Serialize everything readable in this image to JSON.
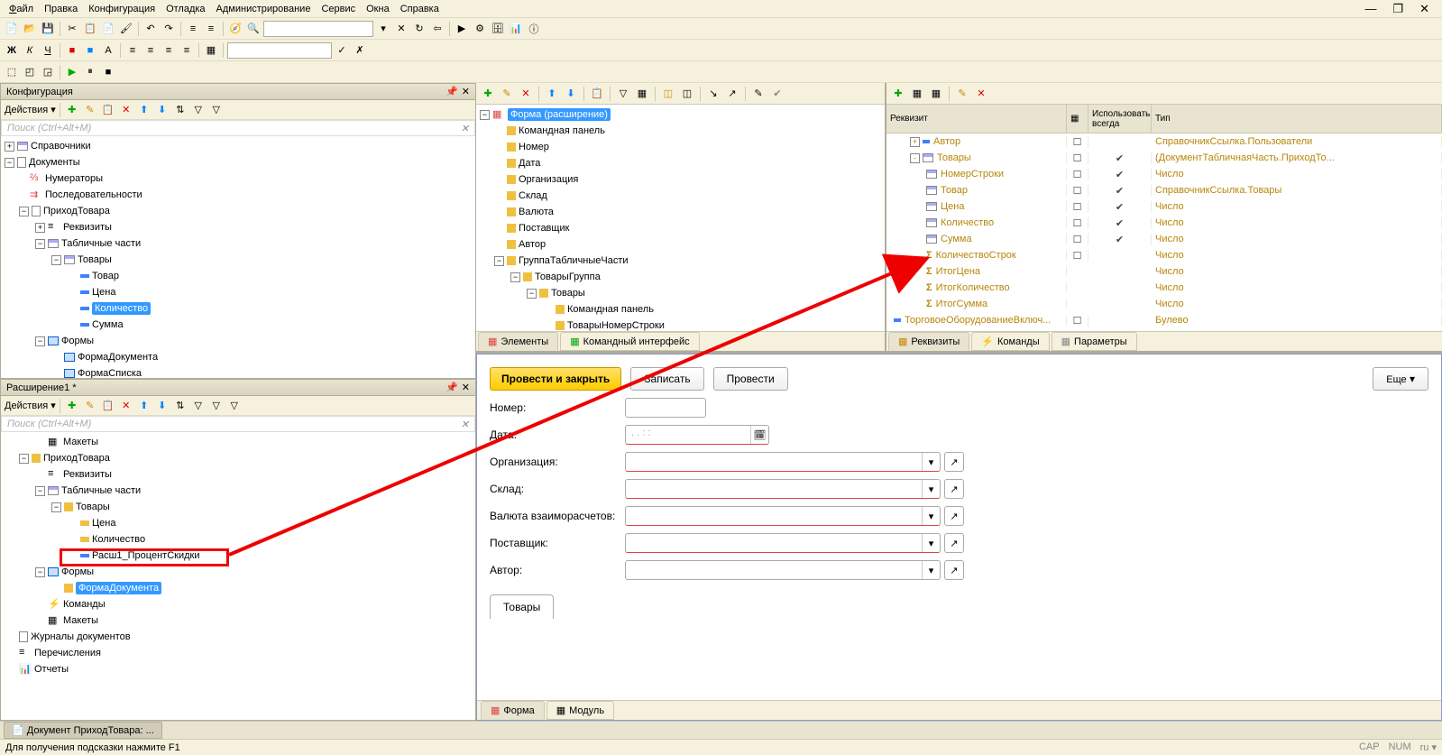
{
  "menu": [
    "Файл",
    "Правка",
    "Конфигурация",
    "Отладка",
    "Администрирование",
    "Сервис",
    "Окна",
    "Справка"
  ],
  "panels": {
    "config": {
      "title": "Конфигурация",
      "actions": "Действия",
      "search": "Поиск (Ctrl+Alt+M)"
    },
    "ext": {
      "title": "Расширение1 *",
      "actions": "Действия",
      "search": "Поиск (Ctrl+Alt+M)"
    }
  },
  "cfgTree": {
    "spravochniki": "Справочники",
    "dokumenty": "Документы",
    "numeratory": "Нумераторы",
    "posled": "Последовательности",
    "prihod": "ПриходТовара",
    "rekvizity": "Реквизиты",
    "tabparts": "Табличные части",
    "tovary": "Товары",
    "tovar": "Товар",
    "cena": "Цена",
    "kolvo": "Количество",
    "summa": "Сумма",
    "formy": "Формы",
    "formaDoc": "ФормаДокумента",
    "formaList": "ФормаСписка"
  },
  "extTree": {
    "makety": "Макеты",
    "prihod": "ПриходТовара",
    "rekvizity": "Реквизиты",
    "tabparts": "Табличные части",
    "tovary": "Товары",
    "cena": "Цена",
    "kolvo": "Количество",
    "rassh": "Расш1_ПроцентСкидки",
    "formy": "Формы",
    "formaDoc": "ФормаДокумента",
    "komandy": "Команды",
    "makety2": "Макеты",
    "zhurnaly": "Журналы документов",
    "perech": "Перечисления",
    "otchety": "Отчеты"
  },
  "formTree": {
    "forma": "Форма (расширение)",
    "cmdpanel": "Командная панель",
    "nomer": "Номер",
    "data": "Дата",
    "org": "Организация",
    "sklad": "Склад",
    "valuta": "Валюта",
    "postav": "Поставщик",
    "avtor": "Автор",
    "grptab": "ГруппаТабличныеЧасти",
    "tovgrp": "ТоварыГруппа",
    "tovary": "Товары",
    "cmdpanel2": "Командная панель",
    "tovnomer": "ТоварыНомерСтроки"
  },
  "elemTabs": {
    "elements": "Элементы",
    "cmdint": "Командный интерфейс"
  },
  "attrHeader": {
    "rekv": "Реквизит",
    "use": "Использовать всегда",
    "tip": "Тип"
  },
  "attrs": [
    {
      "ind": 1,
      "exp": "+",
      "icon": "blue",
      "name": "Автор",
      "c2": "☐",
      "c3": "",
      "tip": "СправочникСсылка.Пользователи"
    },
    {
      "ind": 1,
      "exp": "-",
      "icon": "grid",
      "name": "Товары",
      "c2": "☐",
      "c3": "✔",
      "tip": "(ДокументТабличнаяЧасть.ПриходТо..."
    },
    {
      "ind": 2,
      "icon": "grid",
      "name": "НомерСтроки",
      "c2": "☐",
      "c3": "✔",
      "tip": "Число"
    },
    {
      "ind": 2,
      "icon": "grid",
      "name": "Товар",
      "c2": "☐",
      "c3": "✔",
      "tip": "СправочникСсылка.Товары"
    },
    {
      "ind": 2,
      "icon": "grid",
      "name": "Цена",
      "c2": "☐",
      "c3": "✔",
      "tip": "Число"
    },
    {
      "ind": 2,
      "icon": "grid",
      "name": "Количество",
      "c2": "☐",
      "c3": "✔",
      "tip": "Число"
    },
    {
      "ind": 2,
      "icon": "grid",
      "name": "Сумма",
      "c2": "☐",
      "c3": "✔",
      "tip": "Число"
    },
    {
      "ind": 2,
      "icon": "sum",
      "name": "КоличествоСтрок",
      "c2": "☐",
      "c3": "",
      "tip": "Число"
    },
    {
      "ind": 2,
      "icon": "sum",
      "name": "ИтогЦена",
      "c2": "",
      "c3": "",
      "tip": "Число"
    },
    {
      "ind": 2,
      "icon": "sum",
      "name": "ИтогКоличество",
      "c2": "",
      "c3": "",
      "tip": "Число"
    },
    {
      "ind": 2,
      "icon": "sum",
      "name": "ИтогСумма",
      "c2": "",
      "c3": "",
      "tip": "Число"
    },
    {
      "ind": 0,
      "icon": "blue",
      "name": "ТорговоеОборудованиеВключ...",
      "c2": "☐",
      "c3": "",
      "tip": "Булево"
    }
  ],
  "attrTabs": {
    "rekv": "Реквизиты",
    "kom": "Команды",
    "param": "Параметры"
  },
  "preview": {
    "postClose": "Провести и закрыть",
    "zapisat": "Записать",
    "provesti": "Провести",
    "eshe": "Еще",
    "nomer": "Номер:",
    "data": "Дата:",
    "dateph": ".  .       :  :",
    "org": "Организация:",
    "sklad": "Склад:",
    "valuta": "Валюта взаиморасчетов:",
    "postav": "Поставщик:",
    "avtor": "Автор:",
    "tovary": "Товары"
  },
  "botTabs": {
    "forma": "Форма",
    "modul": "Модуль"
  },
  "wintab": "Документ ПриходТовара: ...",
  "status": {
    "hint": "Для получения подсказки нажмите F1",
    "cap": "CAP",
    "num": "NUM",
    "lang": "ru"
  }
}
